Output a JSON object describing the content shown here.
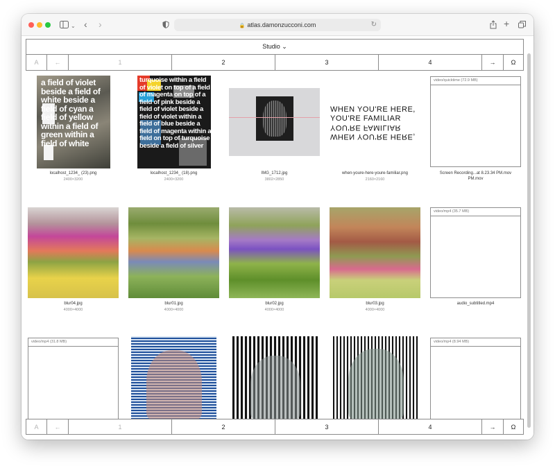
{
  "browser": {
    "url": "atlas.damonzucconi.com",
    "traffic_lights": {
      "close": "#ff5f57",
      "minimize": "#febc2e",
      "maximize": "#28c840"
    },
    "icons": [
      "sidebar-icon",
      "chevron-down-icon",
      "back-icon",
      "forward-icon",
      "shield-icon",
      "lock-icon",
      "reload-icon",
      "share-icon",
      "plus-icon",
      "tabs-icon"
    ]
  },
  "header": {
    "title": "Studio ⌄"
  },
  "pagination": {
    "first": "A",
    "prev": "←",
    "pages": [
      "1",
      "2",
      "3",
      "4"
    ],
    "next": "→",
    "end": "Ω"
  },
  "items": [
    {
      "name": "localhost_1234_ (23).png",
      "dims": "2400×3200",
      "overlay_text": "a field of violet beside a field of white beside a field of cyan a field of yellow within a field of green within a field of white"
    },
    {
      "name": "localhost_1234_ (18).png",
      "dims": "2400×3200",
      "overlay_text": "turquoise within a field of violet on top of a field of magenta on top of a field of pink beside a field of violet beside a field of violet within a field of blue beside a field of magenta within a field on top of turquoise beside a field of silver"
    },
    {
      "name": "IMG_1712.jpg",
      "dims": "3802×2850"
    },
    {
      "name": "when-youre-here-youre-familiar.png",
      "dims": "2160×2160",
      "text_upright": "WHEN YOU'RE HERE,",
      "text_mirror": "YOU'RE FAMILIAR"
    },
    {
      "name": "Screen Recording...at 8.23.34 PM.mov",
      "video_label": "video/quicktime (72.9 MB)"
    },
    {
      "name": "blur04.jpg",
      "dims": "4000×4000"
    },
    {
      "name": "blur01.jpg",
      "dims": "4000×4000"
    },
    {
      "name": "blur02.jpg",
      "dims": "4000×4000"
    },
    {
      "name": "blur03.jpg",
      "dims": "4000×4000"
    },
    {
      "name": "audio_subtitled.mp4",
      "video_label": "video/mp4 (35.7 MB)"
    },
    {
      "video_label": "video/mp4 (31.8 MB)"
    },
    {},
    {},
    {},
    {
      "video_label": "video/mp4 (8.94 MB)"
    }
  ]
}
